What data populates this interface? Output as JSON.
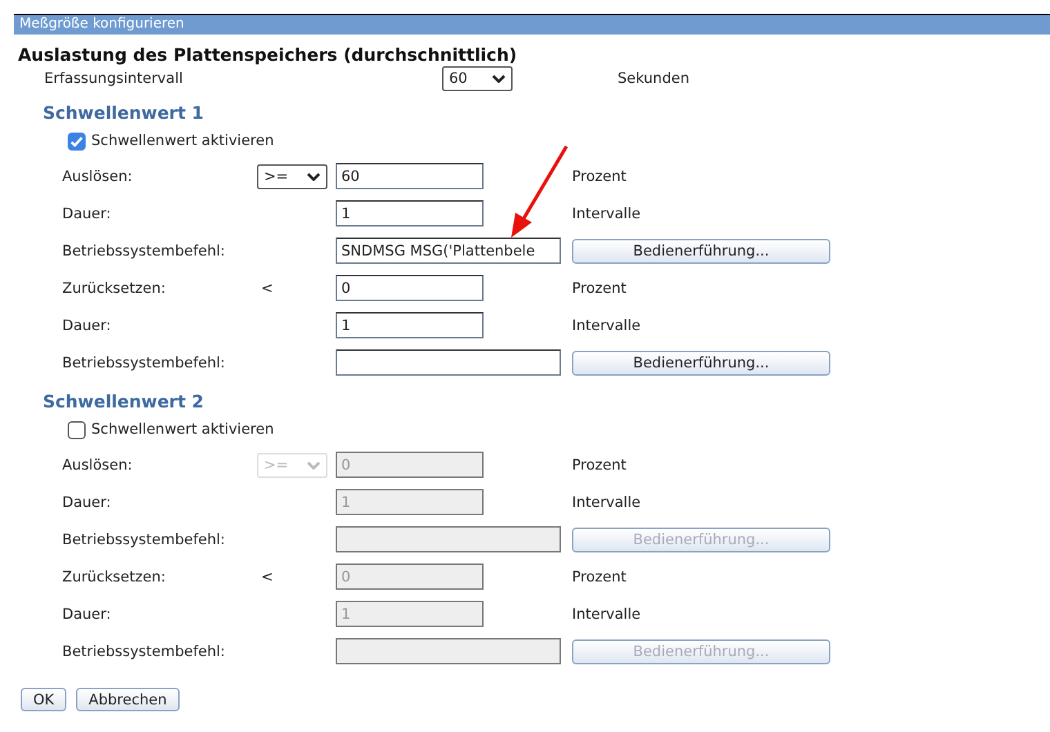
{
  "window": {
    "title": "Meßgröße konfigurieren"
  },
  "heading": "Auslastung des Plattenspeichers (durchschnittlich)",
  "interval": {
    "label": "Erfassungsintervall",
    "value": "60",
    "unit": "Sekunden"
  },
  "thresholds": [
    {
      "title": "Schwellenwert 1",
      "enable": {
        "label": "Schwellenwert aktivieren",
        "checked": true
      },
      "rows": [
        {
          "kind": "number",
          "label": "Auslösen:",
          "operator": {
            "kind": "select",
            "text": ">="
          },
          "value": "60",
          "unit": "Prozent"
        },
        {
          "kind": "number",
          "label": "Dauer:",
          "value": "1",
          "unit": "Intervalle"
        },
        {
          "kind": "command",
          "label": "Betriebssystembefehl:",
          "value": "SNDMSG MSG('Plattenbele",
          "button": "Bedienerführung..."
        },
        {
          "kind": "number",
          "label": "Zurücksetzen:",
          "operator": {
            "kind": "text",
            "text": "<"
          },
          "value": "0",
          "unit": "Prozent"
        },
        {
          "kind": "number",
          "label": "Dauer:",
          "value": "1",
          "unit": "Intervalle"
        },
        {
          "kind": "command",
          "label": "Betriebssystembefehl:",
          "button": "Bedienerführung..."
        }
      ]
    },
    {
      "title": "Schwellenwert 2",
      "enable": {
        "label": "Schwellenwert aktivieren",
        "checked": false
      },
      "rows": [
        {
          "kind": "number",
          "label": "Auslösen:",
          "operator": {
            "kind": "select",
            "text": ">="
          },
          "value": "0",
          "unit": "Prozent"
        },
        {
          "kind": "number",
          "label": "Dauer:",
          "value": "1",
          "unit": "Intervalle"
        },
        {
          "kind": "command",
          "label": "Betriebssystembefehl:",
          "button": "Bedienerführung..."
        },
        {
          "kind": "number",
          "label": "Zurücksetzen:",
          "operator": {
            "kind": "text",
            "text": "<"
          },
          "value": "0",
          "unit": "Prozent"
        },
        {
          "kind": "number",
          "label": "Dauer:",
          "value": "1",
          "unit": "Intervalle"
        },
        {
          "kind": "command",
          "label": "Betriebssystembefehl:",
          "button": "Bedienerführung..."
        }
      ]
    }
  ],
  "buttons": [
    "OK",
    "Abbrechen"
  ]
}
